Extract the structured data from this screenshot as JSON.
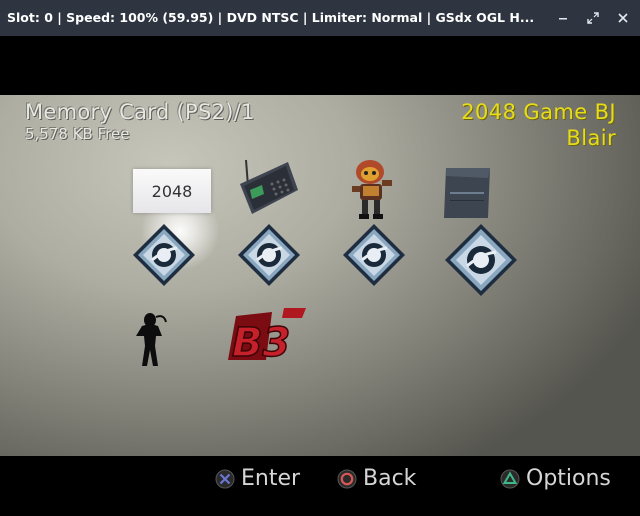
{
  "window": {
    "title": "Slot: 0 | Speed: 100% (59.95) | DVD NTSC | Limiter: Normal | GSdx OGL H..."
  },
  "header": {
    "card_name": "Memory Card (PS2)/1",
    "free_space": "5,578 KB Free",
    "save_title_line1": "2048 Game  BJ",
    "save_title_line2": "Blair"
  },
  "saves": {
    "first_icon_label": "2048"
  },
  "controls": {
    "enter_label": "Enter",
    "back_label": "Back",
    "options_label": "Options",
    "cross_color": "#6b76d2",
    "circle_color": "#d85858",
    "triangle_color": "#3fb98a"
  },
  "icons": [
    "2048-save-icon",
    "radio-save-icon",
    "robot-save-icon",
    "console-save-icon",
    "ps2-logo-save-icon",
    "ps2-logo-save-icon",
    "ps2-logo-save-icon",
    "ps2-logo-save-icon",
    "silhouette-save-icon",
    "b3-logo-save-icon"
  ]
}
